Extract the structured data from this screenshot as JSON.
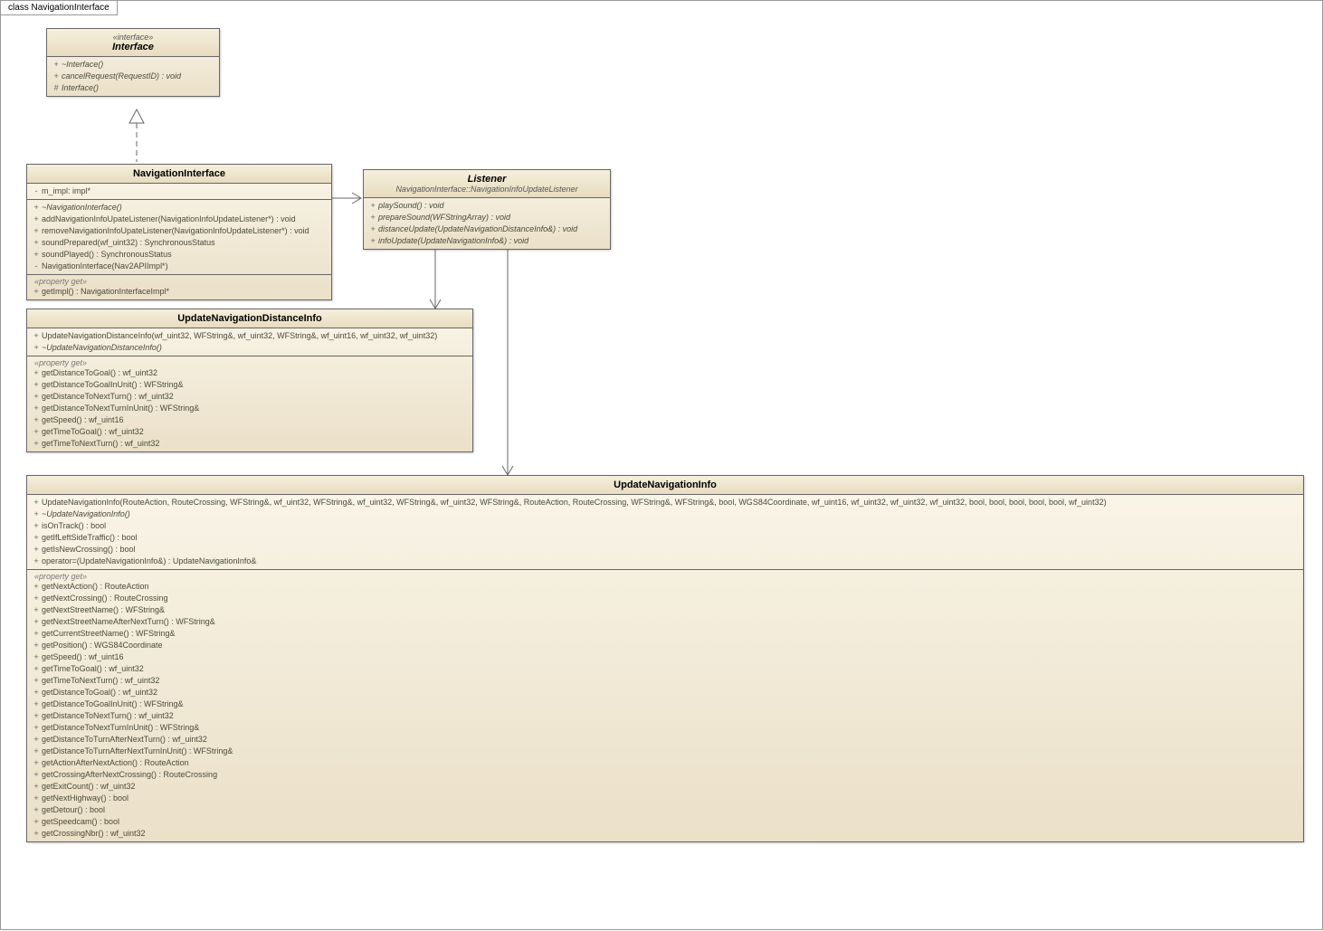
{
  "diagram_title": "class NavigationInterface",
  "interface": {
    "stereotype": "«interface»",
    "name": "Interface",
    "ops": [
      {
        "vis": "+",
        "sig": "~Interface()",
        "italic": true
      },
      {
        "vis": "+",
        "sig": "cancelRequest(RequestID) : void",
        "italic": true
      },
      {
        "vis": "#",
        "sig": "Interface()",
        "italic": true
      }
    ]
  },
  "nav_iface": {
    "name": "NavigationInterface",
    "attrs": [
      {
        "vis": "-",
        "sig": "m_impl:  impl*"
      }
    ],
    "ops": [
      {
        "vis": "+",
        "sig": "~NavigationInterface()",
        "italic": true
      },
      {
        "vis": "+",
        "sig": "addNavigationInfoUpateListener(NavigationInfoUpdateListener*) : void"
      },
      {
        "vis": "+",
        "sig": "removeNavigationInfoUpateListener(NavigationInfoUpdateListener*) : void"
      },
      {
        "vis": "+",
        "sig": "soundPrepared(wf_uint32) : SynchronousStatus"
      },
      {
        "vis": "+",
        "sig": "soundPlayed() : SynchronousStatus"
      },
      {
        "vis": "-",
        "sig": "NavigationInterface(Nav2APIImpl*)"
      }
    ],
    "prop_label": "«property get»",
    "props": [
      {
        "vis": "+",
        "sig": "getImpl() : NavigationInterfaceImpl*"
      }
    ]
  },
  "listener": {
    "name": "Listener",
    "sub": "NavigationInterface::NavigationInfoUpdateListener",
    "ops": [
      {
        "vis": "+",
        "sig": "playSound() : void",
        "italic": true
      },
      {
        "vis": "+",
        "sig": "prepareSound(WFStringArray) : void",
        "italic": true
      },
      {
        "vis": "+",
        "sig": "distanceUpdate(UpdateNavigationDistanceInfo&) : void",
        "italic": true
      },
      {
        "vis": "+",
        "sig": "infoUpdate(UpdateNavigationInfo&) : void",
        "italic": true
      }
    ]
  },
  "dist_info": {
    "name": "UpdateNavigationDistanceInfo",
    "ops": [
      {
        "vis": "+",
        "sig": "UpdateNavigationDistanceInfo(wf_uint32, WFString&, wf_uint32, WFString&, wf_uint16, wf_uint32, wf_uint32)"
      },
      {
        "vis": "+",
        "sig": "~UpdateNavigationDistanceInfo()",
        "italic": true
      }
    ],
    "prop_label": "«property get»",
    "props": [
      {
        "vis": "+",
        "sig": "getDistanceToGoal() : wf_uint32"
      },
      {
        "vis": "+",
        "sig": "getDistanceToGoalInUnit() : WFString&"
      },
      {
        "vis": "+",
        "sig": "getDistanceToNextTurn() : wf_uint32"
      },
      {
        "vis": "+",
        "sig": "getDistanceToNextTurnInUnit() : WFString&"
      },
      {
        "vis": "+",
        "sig": "getSpeed() : wf_uint16"
      },
      {
        "vis": "+",
        "sig": "getTimeToGoal() : wf_uint32"
      },
      {
        "vis": "+",
        "sig": "getTimeToNextTurn() : wf_uint32"
      }
    ]
  },
  "upd_info": {
    "name": "UpdateNavigationInfo",
    "ops": [
      {
        "vis": "+",
        "sig": "UpdateNavigationInfo(RouteAction, RouteCrossing, WFString&, wf_uint32, WFString&, wf_uint32, WFString&, wf_uint32, WFString&, RouteAction, RouteCrossing, WFString&, WFString&, bool, WGS84Coordinate, wf_uint16, wf_uint32, wf_uint32, wf_uint32, bool, bool, bool, bool, bool, wf_uint32)"
      },
      {
        "vis": "+",
        "sig": "~UpdateNavigationInfo()",
        "italic": true
      },
      {
        "vis": "+",
        "sig": "isOnTrack() : bool"
      },
      {
        "vis": "+",
        "sig": "getIfLeftSideTraffic() : bool"
      },
      {
        "vis": "+",
        "sig": "getIsNewCrossing() : bool"
      },
      {
        "vis": "+",
        "sig": "operator=(UpdateNavigationInfo&) : UpdateNavigationInfo&"
      }
    ],
    "prop_label": "«property get»",
    "props": [
      {
        "vis": "+",
        "sig": "getNextAction() : RouteAction"
      },
      {
        "vis": "+",
        "sig": "getNextCrossing() : RouteCrossing"
      },
      {
        "vis": "+",
        "sig": "getNextStreetName() : WFString&"
      },
      {
        "vis": "+",
        "sig": "getNextStreetNameAfterNextTurn() : WFString&"
      },
      {
        "vis": "+",
        "sig": "getCurrentStreetName() : WFString&"
      },
      {
        "vis": "+",
        "sig": "getPosition() : WGS84Coordinate"
      },
      {
        "vis": "+",
        "sig": "getSpeed() : wf_uint16"
      },
      {
        "vis": "+",
        "sig": "getTimeToGoal() : wf_uint32"
      },
      {
        "vis": "+",
        "sig": "getTimeToNextTurn() : wf_uint32"
      },
      {
        "vis": "+",
        "sig": "getDistanceToGoal() : wf_uint32"
      },
      {
        "vis": "+",
        "sig": "getDistanceToGoalInUnit() : WFString&"
      },
      {
        "vis": "+",
        "sig": "getDistanceToNextTurn() : wf_uint32"
      },
      {
        "vis": "+",
        "sig": "getDistanceToNextTurnInUnit() : WFString&"
      },
      {
        "vis": "+",
        "sig": "getDistanceToTurnAfterNextTurn() : wf_uint32"
      },
      {
        "vis": "+",
        "sig": "getDistanceToTurnAfterNextTurnInUnit() : WFString&"
      },
      {
        "vis": "+",
        "sig": "getActionAfterNextAction() : RouteAction"
      },
      {
        "vis": "+",
        "sig": "getCrossingAfterNextCrossing() : RouteCrossing"
      },
      {
        "vis": "+",
        "sig": "getExitCount() : wf_uint32"
      },
      {
        "vis": "+",
        "sig": "getNextHighway() : bool"
      },
      {
        "vis": "+",
        "sig": "getDetour() : bool"
      },
      {
        "vis": "+",
        "sig": "getSpeedcam() : bool"
      },
      {
        "vis": "+",
        "sig": "getCrossingNbr() : wf_uint32"
      }
    ]
  }
}
